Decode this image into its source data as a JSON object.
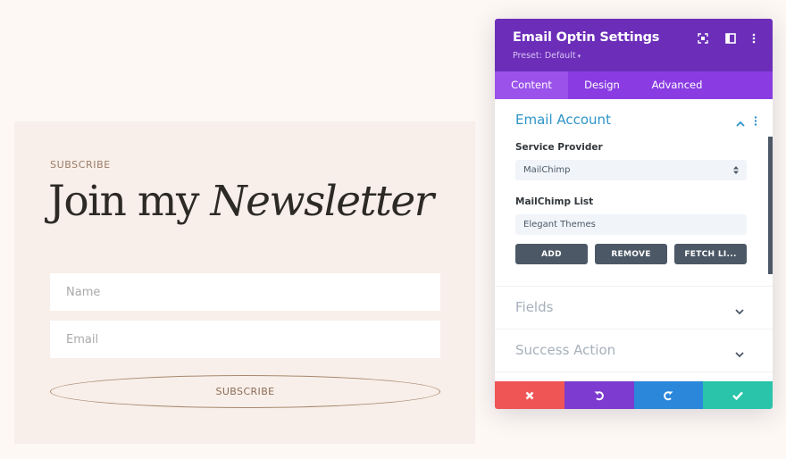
{
  "newsletter": {
    "eyebrow": "SUBSCRIBE",
    "headline_regular": "Join my ",
    "headline_italic": "Newsletter",
    "name_placeholder": "Name",
    "email_placeholder": "Email",
    "subscribe_label": "SUBSCRIBE"
  },
  "panel": {
    "title": "Email Optin Settings",
    "preset_label": "Preset: Default",
    "preset_caret": "▾",
    "header_icons": [
      "expand-icon",
      "sidebar-layout-icon",
      "more-options-icon"
    ],
    "tabs": [
      {
        "label": "Content",
        "active": true
      },
      {
        "label": "Design",
        "active": false
      },
      {
        "label": "Advanced",
        "active": false
      }
    ],
    "sections": [
      {
        "title": "Email Account",
        "expanded": true,
        "service_provider_label": "Service Provider",
        "service_provider_value": "MailChimp",
        "list_label": "MailChimp List",
        "list_value": "Elegant Themes",
        "buttons": [
          "ADD",
          "REMOVE",
          "FETCH LI..."
        ]
      },
      {
        "title": "Fields",
        "expanded": false
      },
      {
        "title": "Success Action",
        "expanded": false
      }
    ],
    "footer": {
      "cancel": "cancel-icon",
      "undo": "undo-icon",
      "redo": "redo-icon",
      "save": "check-icon"
    },
    "colors": {
      "header": "#6c2eb9",
      "tabs": "#8a3ce2",
      "active_tab": "#9b52ea",
      "section_title_active": "#2e94c9",
      "cancel": "#ef5555",
      "undo": "#7d3bcf",
      "redo": "#2b87da",
      "save": "#29c4a9"
    }
  }
}
